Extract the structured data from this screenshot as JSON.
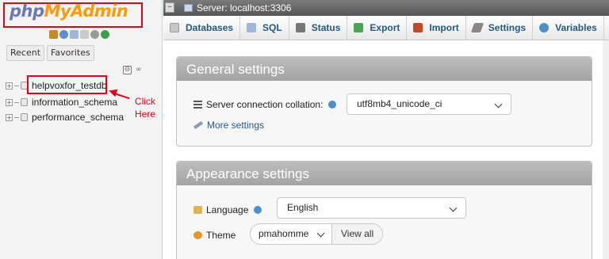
{
  "nav": {
    "logo_part1": "php",
    "logo_part2": "MyAdmin",
    "icons": [
      "home-icon",
      "logout-icon",
      "docs-icon",
      "sql-docs-icon",
      "settings-icon",
      "reload-icon"
    ],
    "tabs": [
      {
        "label": "Recent"
      },
      {
        "label": "Favorites"
      }
    ],
    "collapse_icon": "⊖",
    "link_icon": "∞",
    "databases": [
      {
        "name": "helpvoxfor_testdb"
      },
      {
        "name": "information_schema"
      },
      {
        "name": "performance_schema"
      }
    ],
    "annotation": "Click Here",
    "annotation_color": "#e3001b"
  },
  "server": {
    "label": "Server: localhost:3306"
  },
  "tabs": [
    {
      "label": "Databases",
      "icon": "database-icon"
    },
    {
      "label": "SQL",
      "icon": "sql-icon"
    },
    {
      "label": "Status",
      "icon": "status-icon"
    },
    {
      "label": "Export",
      "icon": "export-icon"
    },
    {
      "label": "Import",
      "icon": "import-icon"
    },
    {
      "label": "Settings",
      "icon": "settings-icon"
    },
    {
      "label": "Variables",
      "icon": "variables-icon"
    }
  ],
  "general": {
    "title": "General settings",
    "collation_label": "Server connection collation:",
    "collation_value": "utf8mb4_unicode_ci",
    "more_settings": "More settings"
  },
  "appearance": {
    "title": "Appearance settings",
    "language_label": "Language",
    "language_value": "English",
    "theme_label": "Theme",
    "theme_value": "pmahomme",
    "view_all": "View all"
  }
}
